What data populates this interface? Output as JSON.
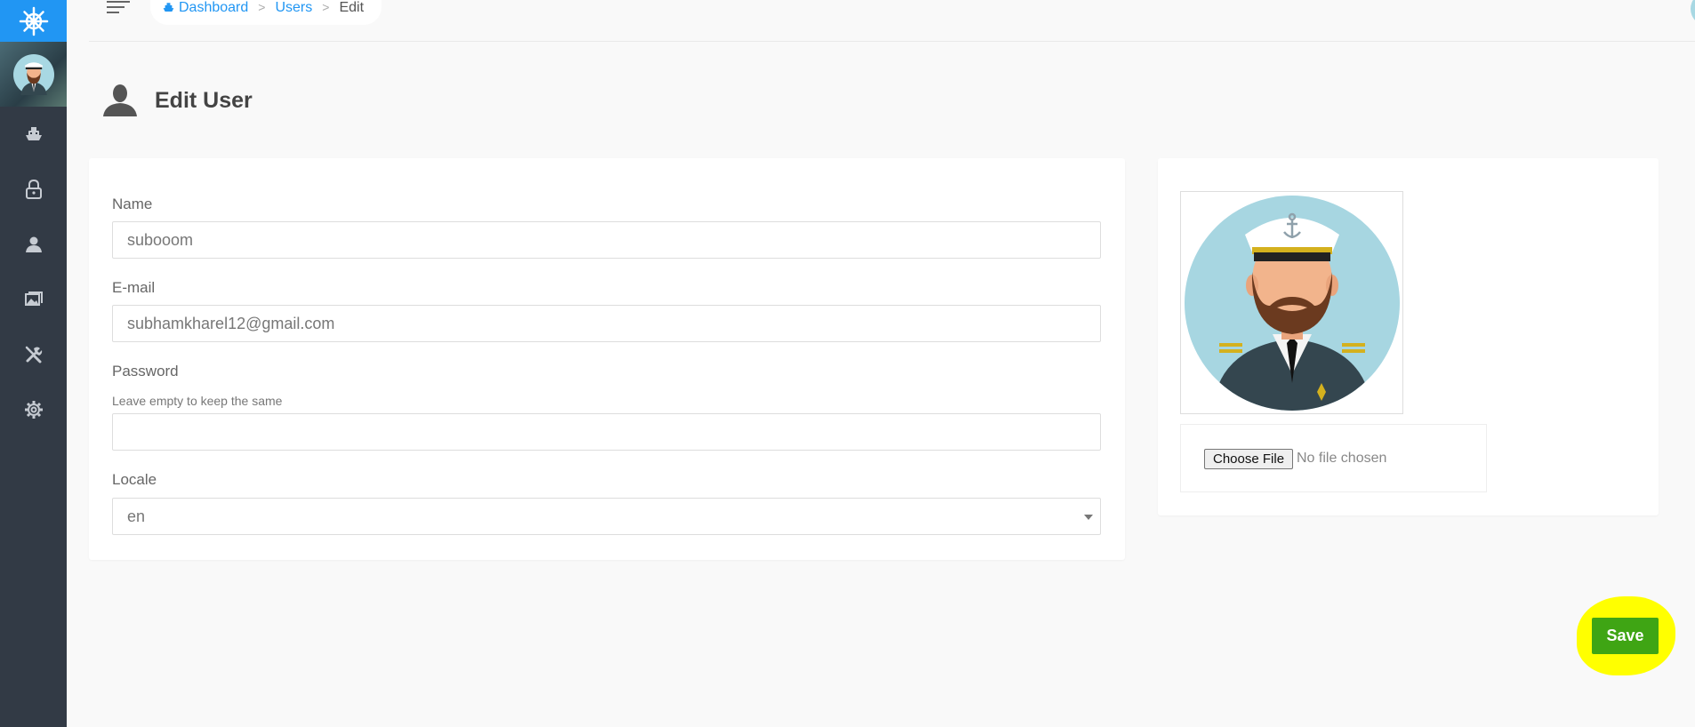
{
  "colors": {
    "sidebar_bg": "#323a45",
    "logo_bg": "#2196f3",
    "link": "#2196f3",
    "save_bg": "#3fa514",
    "highlight": "#ffff00"
  },
  "sidebar": {
    "logo_icon": "ship-wheel-icon",
    "items": [
      {
        "icon": "ship-icon"
      },
      {
        "icon": "lock-icon"
      },
      {
        "icon": "user-icon"
      },
      {
        "icon": "images-icon"
      },
      {
        "icon": "tools-icon"
      },
      {
        "icon": "gear-icon"
      }
    ]
  },
  "breadcrumb": {
    "dashboard": "Dashboard",
    "users": "Users",
    "current": "Edit",
    "separator": ">"
  },
  "page": {
    "title": "Edit User",
    "title_icon": "user-icon"
  },
  "form": {
    "name_label": "Name",
    "name_value": "subooom",
    "email_label": "E-mail",
    "email_value": "subhamkharel12@gmail.com",
    "password_label": "Password",
    "password_hint": "Leave empty to keep the same",
    "password_value": "",
    "locale_label": "Locale",
    "locale_value": "en"
  },
  "image_upload": {
    "choose_label": "Choose File",
    "status": "No file chosen"
  },
  "actions": {
    "save_label": "Save"
  }
}
